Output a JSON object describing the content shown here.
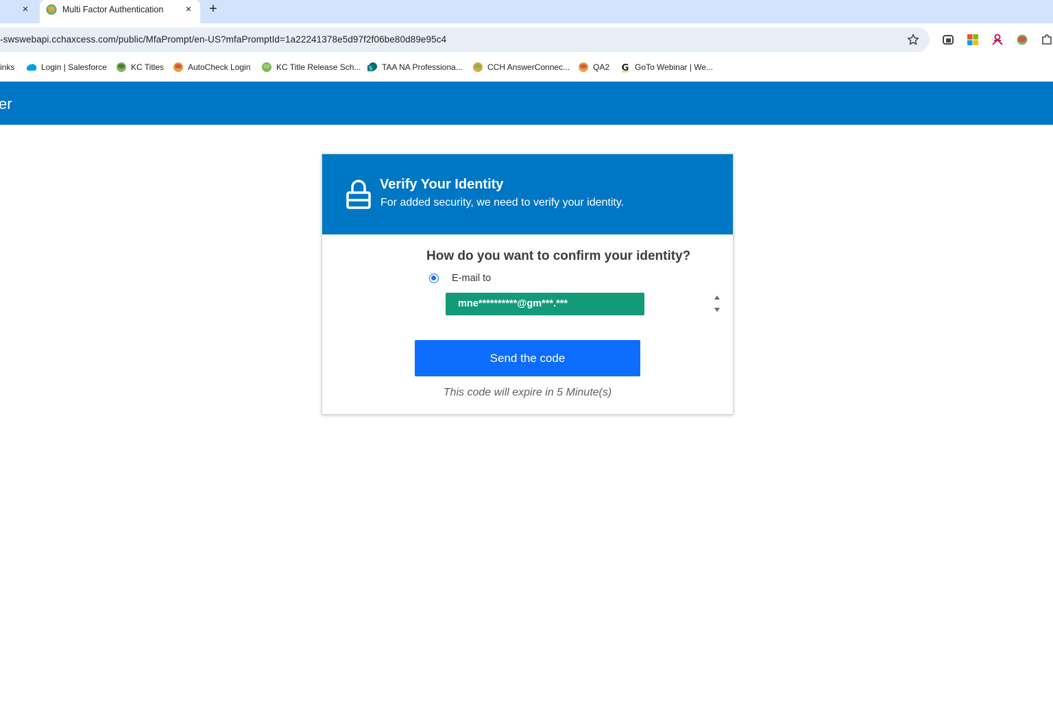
{
  "browser": {
    "prev_tab_close": "×",
    "tab": {
      "title": "Multi Factor Authentication",
      "close": "×"
    },
    "new_tab": "+",
    "url": "-swswebapi.cchaxcess.com/public/MfaPrompt/en-US?mfaPromptId=1a22241378e5d97f2f06be80d89e95c4",
    "bookmarks": [
      {
        "label": "inks",
        "icon": "none"
      },
      {
        "label": "Login | Salesforce",
        "icon": "salesforce-cloud-icon"
      },
      {
        "label": "KC Titles",
        "icon": "globe-favicon-icon"
      },
      {
        "label": "AutoCheck Login",
        "icon": "globe-favicon-icon"
      },
      {
        "label": "KC Title Release Sch...",
        "icon": "globe-favicon-icon"
      },
      {
        "label": "TAA NA Professiona...",
        "icon": "sharepoint-icon"
      },
      {
        "label": "CCH AnswerConnec...",
        "icon": "globe-favicon-icon"
      },
      {
        "label": "QA2",
        "icon": "globe-favicon-icon"
      },
      {
        "label": "GoTo Webinar | We...",
        "icon": "goto-g-icon"
      }
    ],
    "extension_icons": [
      "printer-extension-icon",
      "microsoft-logo-icon",
      "people-extension-icon",
      "globe-extension-icon",
      "puzzle-extensions-icon"
    ]
  },
  "app": {
    "header_title": "er"
  },
  "card": {
    "title": "Verify Your Identity",
    "subtitle": "For added security, we need to verify your identity.",
    "question": "How do you want to confirm your identity?",
    "option_label": "E-mail to",
    "email_value": "mne**********@gm***.***",
    "send_button": "Send the code",
    "expire_note": "This code will expire in 5 Minute(s)"
  },
  "colors": {
    "tabstrip": "#d3e3fd",
    "brand_blue": "#0077c5",
    "email_select": "#139a79",
    "button": "#0d6efd"
  }
}
